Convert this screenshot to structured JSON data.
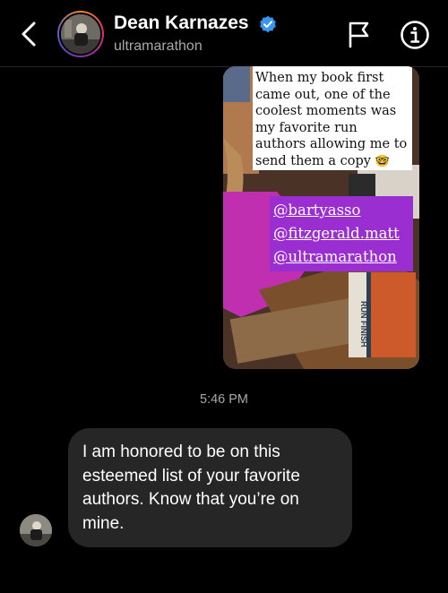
{
  "header": {
    "name": "Dean Karnazes",
    "username": "ultramarathon",
    "icons": [
      "back-chevron-icon",
      "verified-badge-icon",
      "flag-icon",
      "info-icon"
    ]
  },
  "story": {
    "caption": "When my book first came out, one of the coolest moments was my favorite run authors allowing me to send them a copy",
    "caption_emoji": "🤓",
    "mentions": [
      "@bartyasso",
      "@fitzgerald.matt",
      "@ultramarathon"
    ],
    "book_spine_text": "RUN FINISH"
  },
  "timestamp": "5:46 PM",
  "message": {
    "text": "I am honored to be on this esteemed list of your favorite authors. Know that you’re on mine."
  },
  "colors": {
    "background": "#000000",
    "bubble": "#262626",
    "muted_text": "#a8a8a8",
    "verified": "#3897f0",
    "mention_highlight": "#9b2ed0"
  }
}
